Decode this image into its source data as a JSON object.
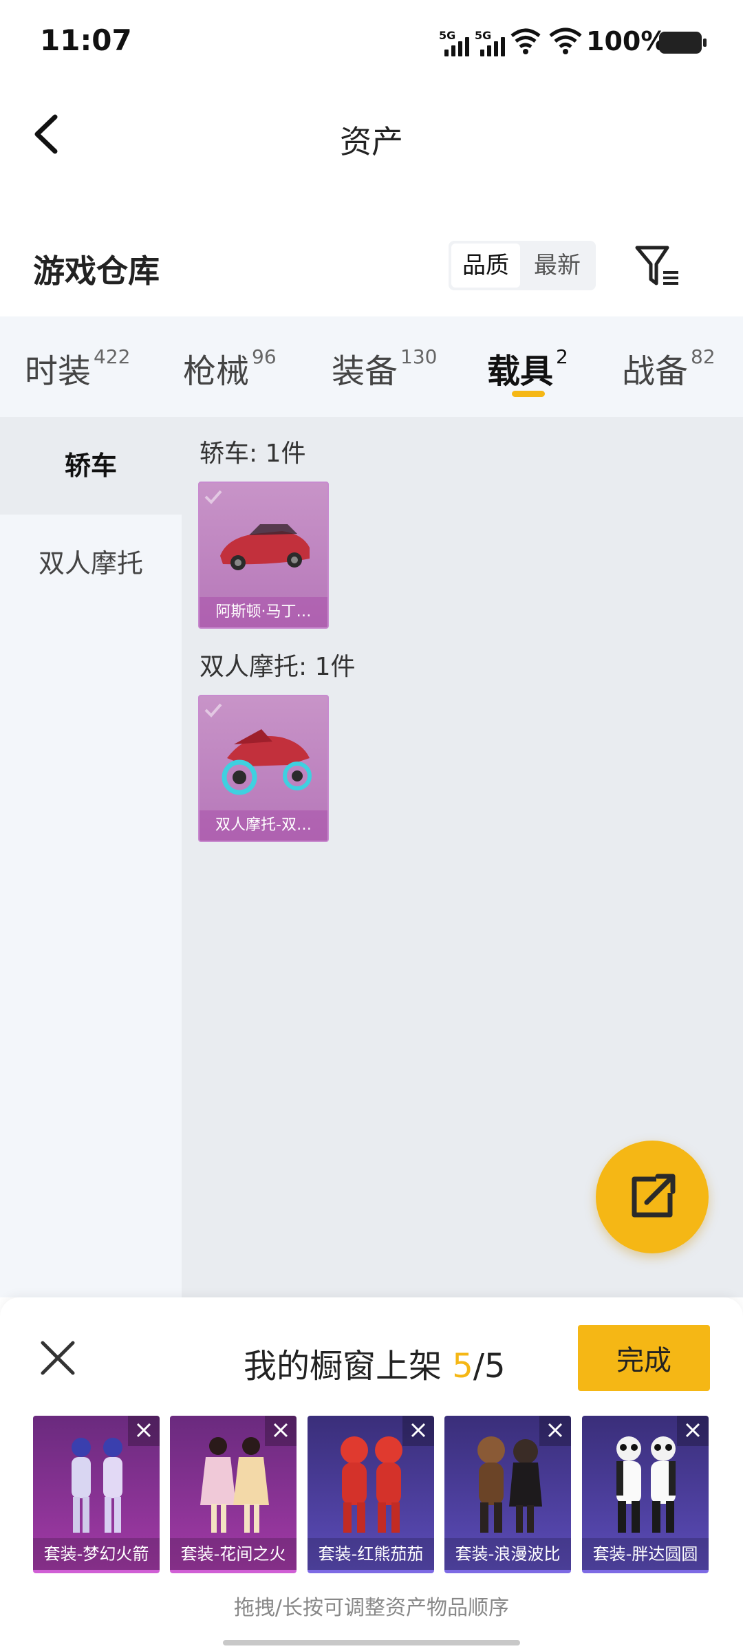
{
  "status_bar": {
    "time": "11:07",
    "sim1": "5G",
    "sim2": "5G",
    "battery": "100%"
  },
  "header": {
    "title": "资产",
    "back_icon": "chevron-left-icon"
  },
  "section": {
    "title": "游戏仓库",
    "sort": {
      "selected": "品质",
      "other": "最新"
    },
    "filter_icon": "filter-icon"
  },
  "tabs": [
    {
      "label": "时装",
      "count": "422"
    },
    {
      "label": "枪械",
      "count": "96"
    },
    {
      "label": "装备",
      "count": "130"
    },
    {
      "label": "载具",
      "count": "2",
      "active": true
    },
    {
      "label": "战备",
      "count": "82"
    }
  ],
  "side_nav": [
    {
      "label": "轿车",
      "active": true
    },
    {
      "label": "双人摩托"
    }
  ],
  "groups": [
    {
      "label": "轿车: 1件",
      "item": {
        "name": "阿斯顿·马丁…",
        "icon": "car-icon"
      }
    },
    {
      "label": "双人摩托: 1件",
      "item": {
        "name": "双人摩托-双…",
        "icon": "motorcycle-icon"
      }
    }
  ],
  "fab": {
    "icon": "share-external-icon"
  },
  "showcase": {
    "title_prefix": "我的橱窗上架",
    "count": "5",
    "total": "/5",
    "done_label": "完成",
    "close_icon": "close-icon",
    "items": [
      {
        "name": "套装-梦幻火箭",
        "theme": "purple"
      },
      {
        "name": "套装-花间之火",
        "theme": "purple"
      },
      {
        "name": "套装-红熊茄茄",
        "theme": "blue"
      },
      {
        "name": "套装-浪漫波比",
        "theme": "blue"
      },
      {
        "name": "套装-胖达圆圆",
        "theme": "blue"
      }
    ],
    "hint": "拖拽/长按可调整资产物品顺序"
  },
  "colors": {
    "accent": "#f5b715",
    "card_purple": "#b677b9",
    "panel_bg": "#e9ecf0",
    "tab_bg": "#f3f6fa"
  }
}
